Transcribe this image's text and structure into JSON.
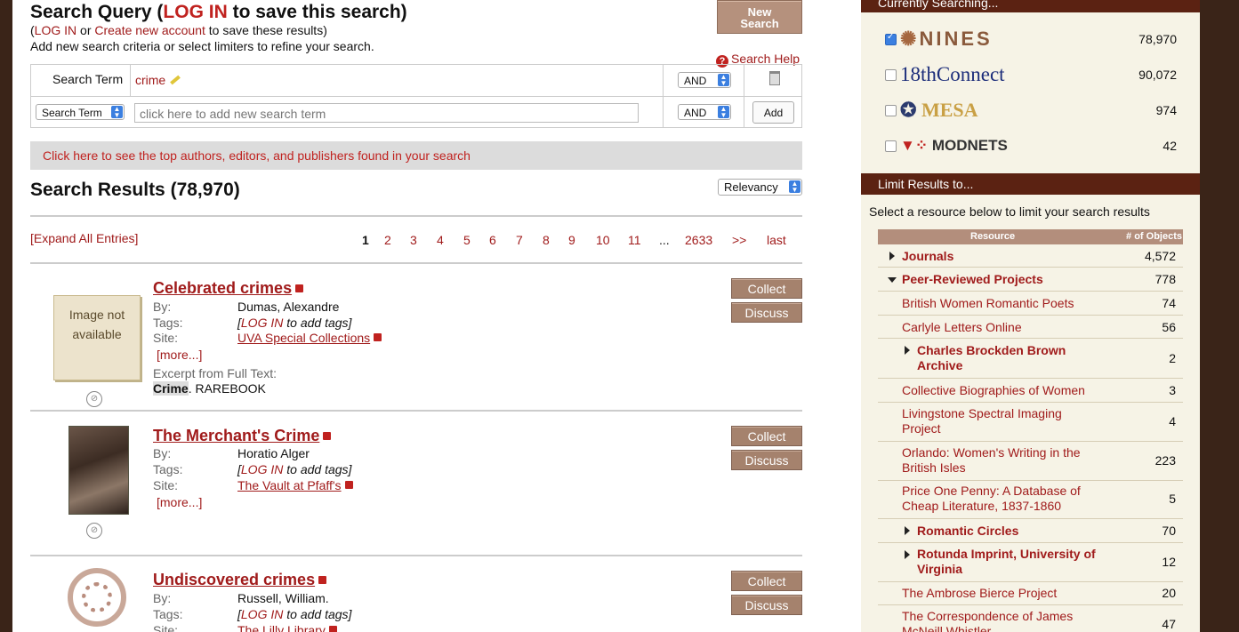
{
  "query": {
    "title_prefix": "Search Query (",
    "title_login": "LOG IN",
    "title_suffix": " to save this search)",
    "sub_open": "(",
    "sub_login": "LOG IN",
    "sub_or": " or ",
    "sub_create": "Create new account",
    "sub_rest": " to save these results)",
    "instructions": "Add new search criteria or select limiters to refine your search.",
    "new_search_line1": "New",
    "new_search_line2": "Search",
    "help": "Search Help"
  },
  "terms": {
    "row1_label": "Search Term",
    "row1_value": "crime",
    "row1_op": "AND",
    "row2_field": "Search Term",
    "row2_placeholder": "click here to add new search term",
    "row2_op": "AND",
    "add_label": "Add"
  },
  "top_authors": "Click here to see the top authors, editors, and publishers found in your search",
  "results": {
    "title": "Search Results (78,970)",
    "sort": "Relevancy",
    "expand_all": "[Expand All Entries]",
    "pages": [
      "1",
      "2",
      "3",
      "4",
      "5",
      "6",
      "7",
      "8",
      "9",
      "10",
      "11",
      "...",
      "2633",
      ">>",
      "last"
    ],
    "current_page": "1",
    "items": [
      {
        "title": "Celebrated crimes",
        "by": "Dumas, Alexandre",
        "tags_login": "LOG IN",
        "tags_rest": " to add tags]",
        "site": "UVA Special Collections",
        "more": "[more...]",
        "thumb_text": "Image not available",
        "excerpt_label": "Excerpt from Full Text:",
        "excerpt_hl": "Crime",
        "excerpt_rest": ". RAREBOOK"
      },
      {
        "title": "The Merchant's Crime",
        "by": "Horatio Alger",
        "tags_login": "LOG IN",
        "tags_rest": " to add tags]",
        "site": "The Vault at Pfaff's",
        "more": "[more...]"
      },
      {
        "title": "Undiscovered crimes",
        "by": "Russell, William.",
        "tags_login": "LOG IN",
        "tags_rest": " to add tags]",
        "site": "The Lilly Library"
      }
    ],
    "labels": {
      "by": "By:",
      "tags": "Tags:",
      "site": "Site:",
      "tags_open": "[",
      "collect": "Collect",
      "discuss": "Discuss"
    }
  },
  "sidebar": {
    "currently_searching": "Currently Searching...",
    "sites": [
      {
        "name": "NINES",
        "count": "78,970",
        "checked": true
      },
      {
        "name": "18thConnect",
        "count": "90,072",
        "checked": false
      },
      {
        "name": "MESA",
        "count": "974",
        "checked": false
      },
      {
        "name": "MODNETS",
        "count": "42",
        "checked": false
      }
    ],
    "limit_title": "Limit Results to...",
    "limit_text": "Select a resource below to limit your search results",
    "col_resource": "Resource",
    "col_objects": "# of Objects",
    "resources": [
      {
        "label": "Journals",
        "count": "4,572"
      },
      {
        "label": "Peer-Reviewed Projects",
        "count": "778"
      },
      {
        "label": "British Women Romantic Poets",
        "count": "74"
      },
      {
        "label": "Carlyle Letters Online",
        "count": "56"
      },
      {
        "label": "Charles Brockden Brown Archive",
        "count": "2"
      },
      {
        "label": "Collective Biographies of Women",
        "count": "3"
      },
      {
        "label": "Livingstone Spectral Imaging Project",
        "count": "4"
      },
      {
        "label": "Orlando: Women's Writing in the British Isles",
        "count": "223"
      },
      {
        "label": "Price One Penny: A Database of Cheap Literature, 1837-1860",
        "count": "5"
      },
      {
        "label": "Romantic Circles",
        "count": "70"
      },
      {
        "label": "Rotunda Imprint, University of Virginia",
        "count": "12"
      },
      {
        "label": "The Ambrose Bierce Project",
        "count": "20"
      },
      {
        "label": "The Correspondence of James McNeill Whistler",
        "count": "47"
      }
    ]
  }
}
